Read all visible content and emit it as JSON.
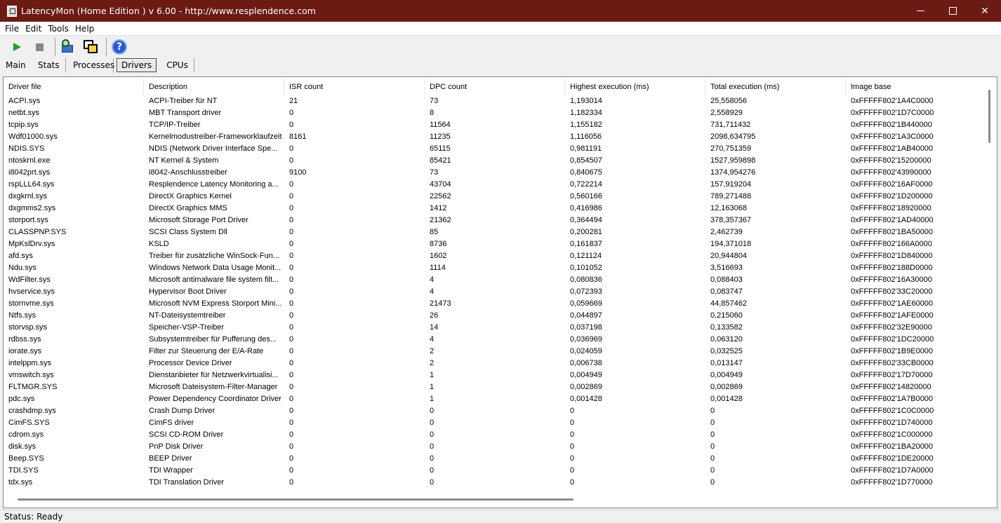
{
  "window": {
    "title": "LatencyMon  (Home Edition )  v 6.00 - http://www.resplendence.com",
    "min_icon": "minimize-icon",
    "max_icon": "maximize-icon",
    "close_glyph": "✕"
  },
  "menu": [
    "File",
    "Edit",
    "Tools",
    "Help"
  ],
  "toolbar": {
    "icons": [
      "play-icon",
      "stop-icon",
      "magnifier-icon",
      "windows-icon",
      "help-icon"
    ],
    "help_glyph": "?"
  },
  "tabs": [
    "Main",
    "Stats",
    "Processes",
    "Drivers",
    "CPUs"
  ],
  "active_tab": "Drivers",
  "table": {
    "columns": [
      "Driver file",
      "Description",
      "ISR count",
      "DPC count",
      "Highest execution (ms)",
      "Total execution (ms)",
      "Image base"
    ],
    "rows": [
      [
        "ACPI.sys",
        "ACPI-Treiber für NT",
        "21",
        "73",
        "1,193014",
        "25,558056",
        "0xFFFFF802'1A4C0000"
      ],
      [
        "netbt.sys",
        "MBT Transport driver",
        "0",
        "8",
        "1,182334",
        "2,558929",
        "0xFFFFF802'1D7C0000"
      ],
      [
        "tcpip.sys",
        "TCP/IP-Treiber",
        "0",
        "11564",
        "1,155182",
        "731,711432",
        "0xFFFFF802'1B440000"
      ],
      [
        "Wdf01000.sys",
        "Kernelmodustreiber-Frameworklaufzeit",
        "8161",
        "11235",
        "1,116056",
        "2098,634795",
        "0xFFFFF802'1A3C0000"
      ],
      [
        "NDIS.SYS",
        "NDIS (Network Driver Interface Spe...",
        "0",
        "65115",
        "0,981191",
        "270,751359",
        "0xFFFFF802'1AB40000"
      ],
      [
        "ntoskrnl.exe",
        "NT Kernel & System",
        "0",
        "85421",
        "0,854507",
        "1527,959898",
        "0xFFFFF802'15200000"
      ],
      [
        "i8042prt.sys",
        "i8042-Anschlusstreiber",
        "9100",
        "73",
        "0,840675",
        "1374,954276",
        "0xFFFFF802'43990000"
      ],
      [
        "rspLLL64.sys",
        "Resplendence Latency Monitoring a...",
        "0",
        "43704",
        "0,722214",
        "157,919204",
        "0xFFFFF802'16AF0000"
      ],
      [
        "dxgkrnl.sys",
        "DirectX Graphics Kernel",
        "0",
        "22562",
        "0,560166",
        "789,271488",
        "0xFFFFF802'1D200000"
      ],
      [
        "dxgmms2.sys",
        "DirectX Graphics MMS",
        "0",
        "1412",
        "0,416986",
        "12,163068",
        "0xFFFFF802'18920000"
      ],
      [
        "storport.sys",
        "Microsoft Storage Port Driver",
        "0",
        "21362",
        "0,364494",
        "378,357367",
        "0xFFFFF802'1AD40000"
      ],
      [
        "CLASSPNP.SYS",
        "SCSI Class System Dll",
        "0",
        "85",
        "0,200281",
        "2,462739",
        "0xFFFFF802'1BA50000"
      ],
      [
        "MpKslDrv.sys",
        "KSLD",
        "0",
        "8736",
        "0,161837",
        "194,371018",
        "0xFFFFF802'166A0000"
      ],
      [
        "afd.sys",
        "Treiber für zusätzliche WinSock-Fun...",
        "0",
        "1602",
        "0,121124",
        "20,944804",
        "0xFFFFF802'1D840000"
      ],
      [
        "Ndu.sys",
        "Windows Network Data Usage Monit...",
        "0",
        "1114",
        "0,101052",
        "3,516693",
        "0xFFFFF802'188D0000"
      ],
      [
        "WdFilter.sys",
        "Microsoft antimalware file system filt...",
        "0",
        "4",
        "0,080836",
        "0,088403",
        "0xFFFFF802'16A30000"
      ],
      [
        "hvservice.sys",
        "Hypervisor Boot Driver",
        "0",
        "4",
        "0,072393",
        "0,083747",
        "0xFFFFF802'33C20000"
      ],
      [
        "stornvme.sys",
        "Microsoft NVM Express Storport Mini...",
        "0",
        "21473",
        "0,059669",
        "44,857462",
        "0xFFFFF802'1AE60000"
      ],
      [
        "Ntfs.sys",
        "NT-Dateisystemtreiber",
        "0",
        "26",
        "0,044897",
        "0,215060",
        "0xFFFFF802'1AFE0000"
      ],
      [
        "storvsp.sys",
        "Speicher-VSP-Treiber",
        "0",
        "14",
        "0,037198",
        "0,133582",
        "0xFFFFF802'32E90000"
      ],
      [
        "rdbss.sys",
        "Subsystemtreiber für Pufferung des...",
        "0",
        "4",
        "0,036969",
        "0,063120",
        "0xFFFFF802'1DC20000"
      ],
      [
        "iorate.sys",
        "Filter zur Steuerung der E/A-Rate",
        "0",
        "2",
        "0,024059",
        "0,032525",
        "0xFFFFF802'1B9E0000"
      ],
      [
        "intelppm.sys",
        "Processor Device Driver",
        "0",
        "2",
        "0,006738",
        "0,013147",
        "0xFFFFF802'33CB0000"
      ],
      [
        "vmswitch.sys",
        "Dienstanbieter für Netzwerkvirtualisi...",
        "0",
        "1",
        "0,004949",
        "0,004949",
        "0xFFFFF802'17D70000"
      ],
      [
        "FLTMGR.SYS",
        "Microsoft Dateisystem-Filter-Manager",
        "0",
        "1",
        "0,002869",
        "0,002869",
        "0xFFFFF802'14820000"
      ],
      [
        "pdc.sys",
        "Power Dependency Coordinator Driver",
        "0",
        "1",
        "0,001428",
        "0,001428",
        "0xFFFFF802'1A7B0000"
      ],
      [
        "crashdmp.sys",
        "Crash Dump Driver",
        "0",
        "0",
        "0",
        "0",
        "0xFFFFF802'1C0C0000"
      ],
      [
        "CimFS.SYS",
        "CimFS driver",
        "0",
        "0",
        "0",
        "0",
        "0xFFFFF802'1D740000"
      ],
      [
        "cdrom.sys",
        "SCSI CD-ROM Driver",
        "0",
        "0",
        "0",
        "0",
        "0xFFFFF802'1C000000"
      ],
      [
        "disk.sys",
        "PnP Disk Driver",
        "0",
        "0",
        "0",
        "0",
        "0xFFFFF802'1BA20000"
      ],
      [
        "Beep.SYS",
        "BEEP Driver",
        "0",
        "0",
        "0",
        "0",
        "0xFFFFF802'1DE20000"
      ],
      [
        "TDI.SYS",
        "TDI Wrapper",
        "0",
        "0",
        "0",
        "0",
        "0xFFFFF802'1D7A0000"
      ],
      [
        "tdx.sys",
        "TDI Translation Driver",
        "0",
        "0",
        "0",
        "0",
        "0xFFFFF802'1D770000"
      ]
    ]
  },
  "status": "Status: Ready"
}
